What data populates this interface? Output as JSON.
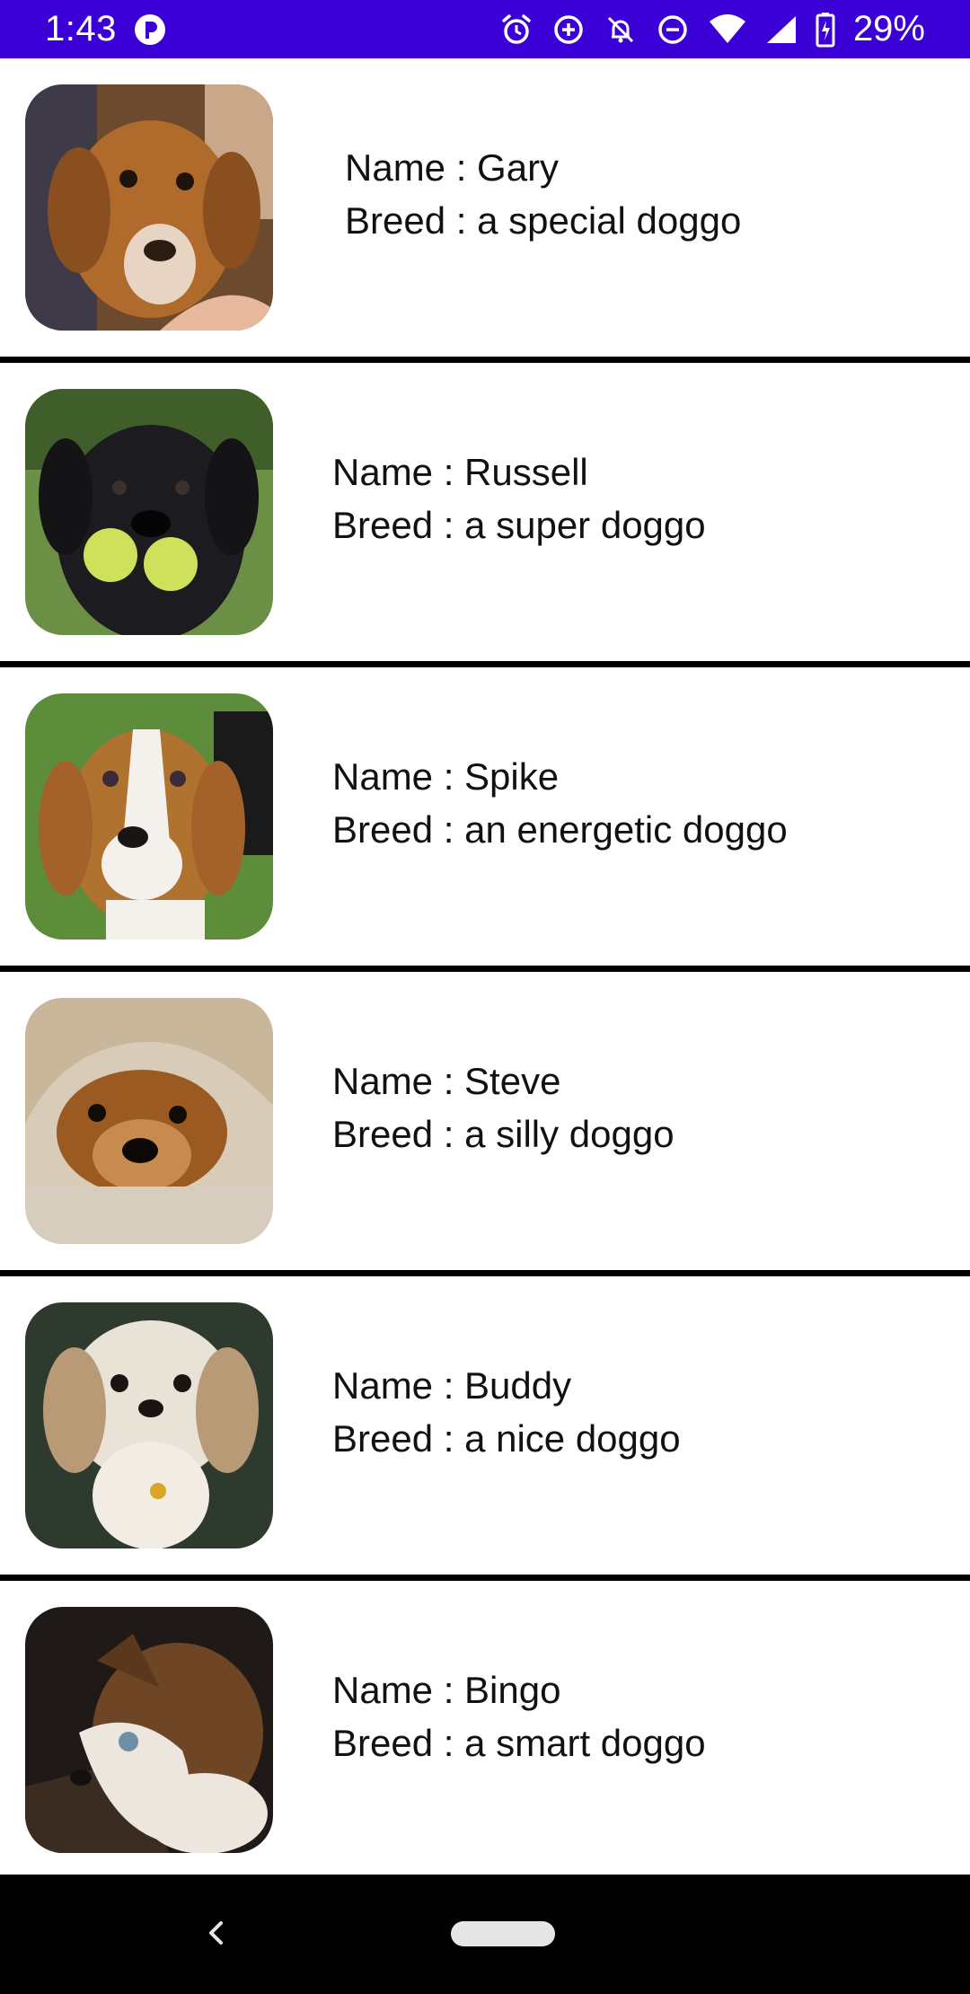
{
  "status_bar": {
    "time": "1:43",
    "battery_percent": "29%",
    "background_color": "#3a00d6",
    "icons_left": [
      "notification-app-icon"
    ],
    "icons_right": [
      "alarm-icon",
      "data-saver-icon",
      "notifications-off-icon",
      "do-not-disturb-icon",
      "wifi-icon",
      "cell-signal-icon",
      "battery-charging-icon"
    ]
  },
  "dogs": [
    {
      "name_line": "Name : Gary",
      "breed_line": "Breed : a special doggo",
      "photo": "brown-puppy-photo"
    },
    {
      "name_line": "Name : Russell",
      "breed_line": "Breed : a super doggo",
      "photo": "black-dog-with-tennis-balls-photo"
    },
    {
      "name_line": "Name : Spike",
      "breed_line": "Breed : an energetic doggo",
      "photo": "beagle-on-grass-photo"
    },
    {
      "name_line": "Name : Steve",
      "breed_line": "Breed : a silly doggo",
      "photo": "dog-under-blanket-photo"
    },
    {
      "name_line": "Name : Buddy",
      "breed_line": "Breed : a nice doggo",
      "photo": "white-shih-tzu-photo"
    },
    {
      "name_line": "Name : Bingo",
      "breed_line": "Breed : a smart doggo",
      "photo": "brown-white-puppy-photo"
    }
  ],
  "nav_bar": {
    "back_icon": "back-chevron-icon",
    "home_icon": "home-pill-icon"
  }
}
